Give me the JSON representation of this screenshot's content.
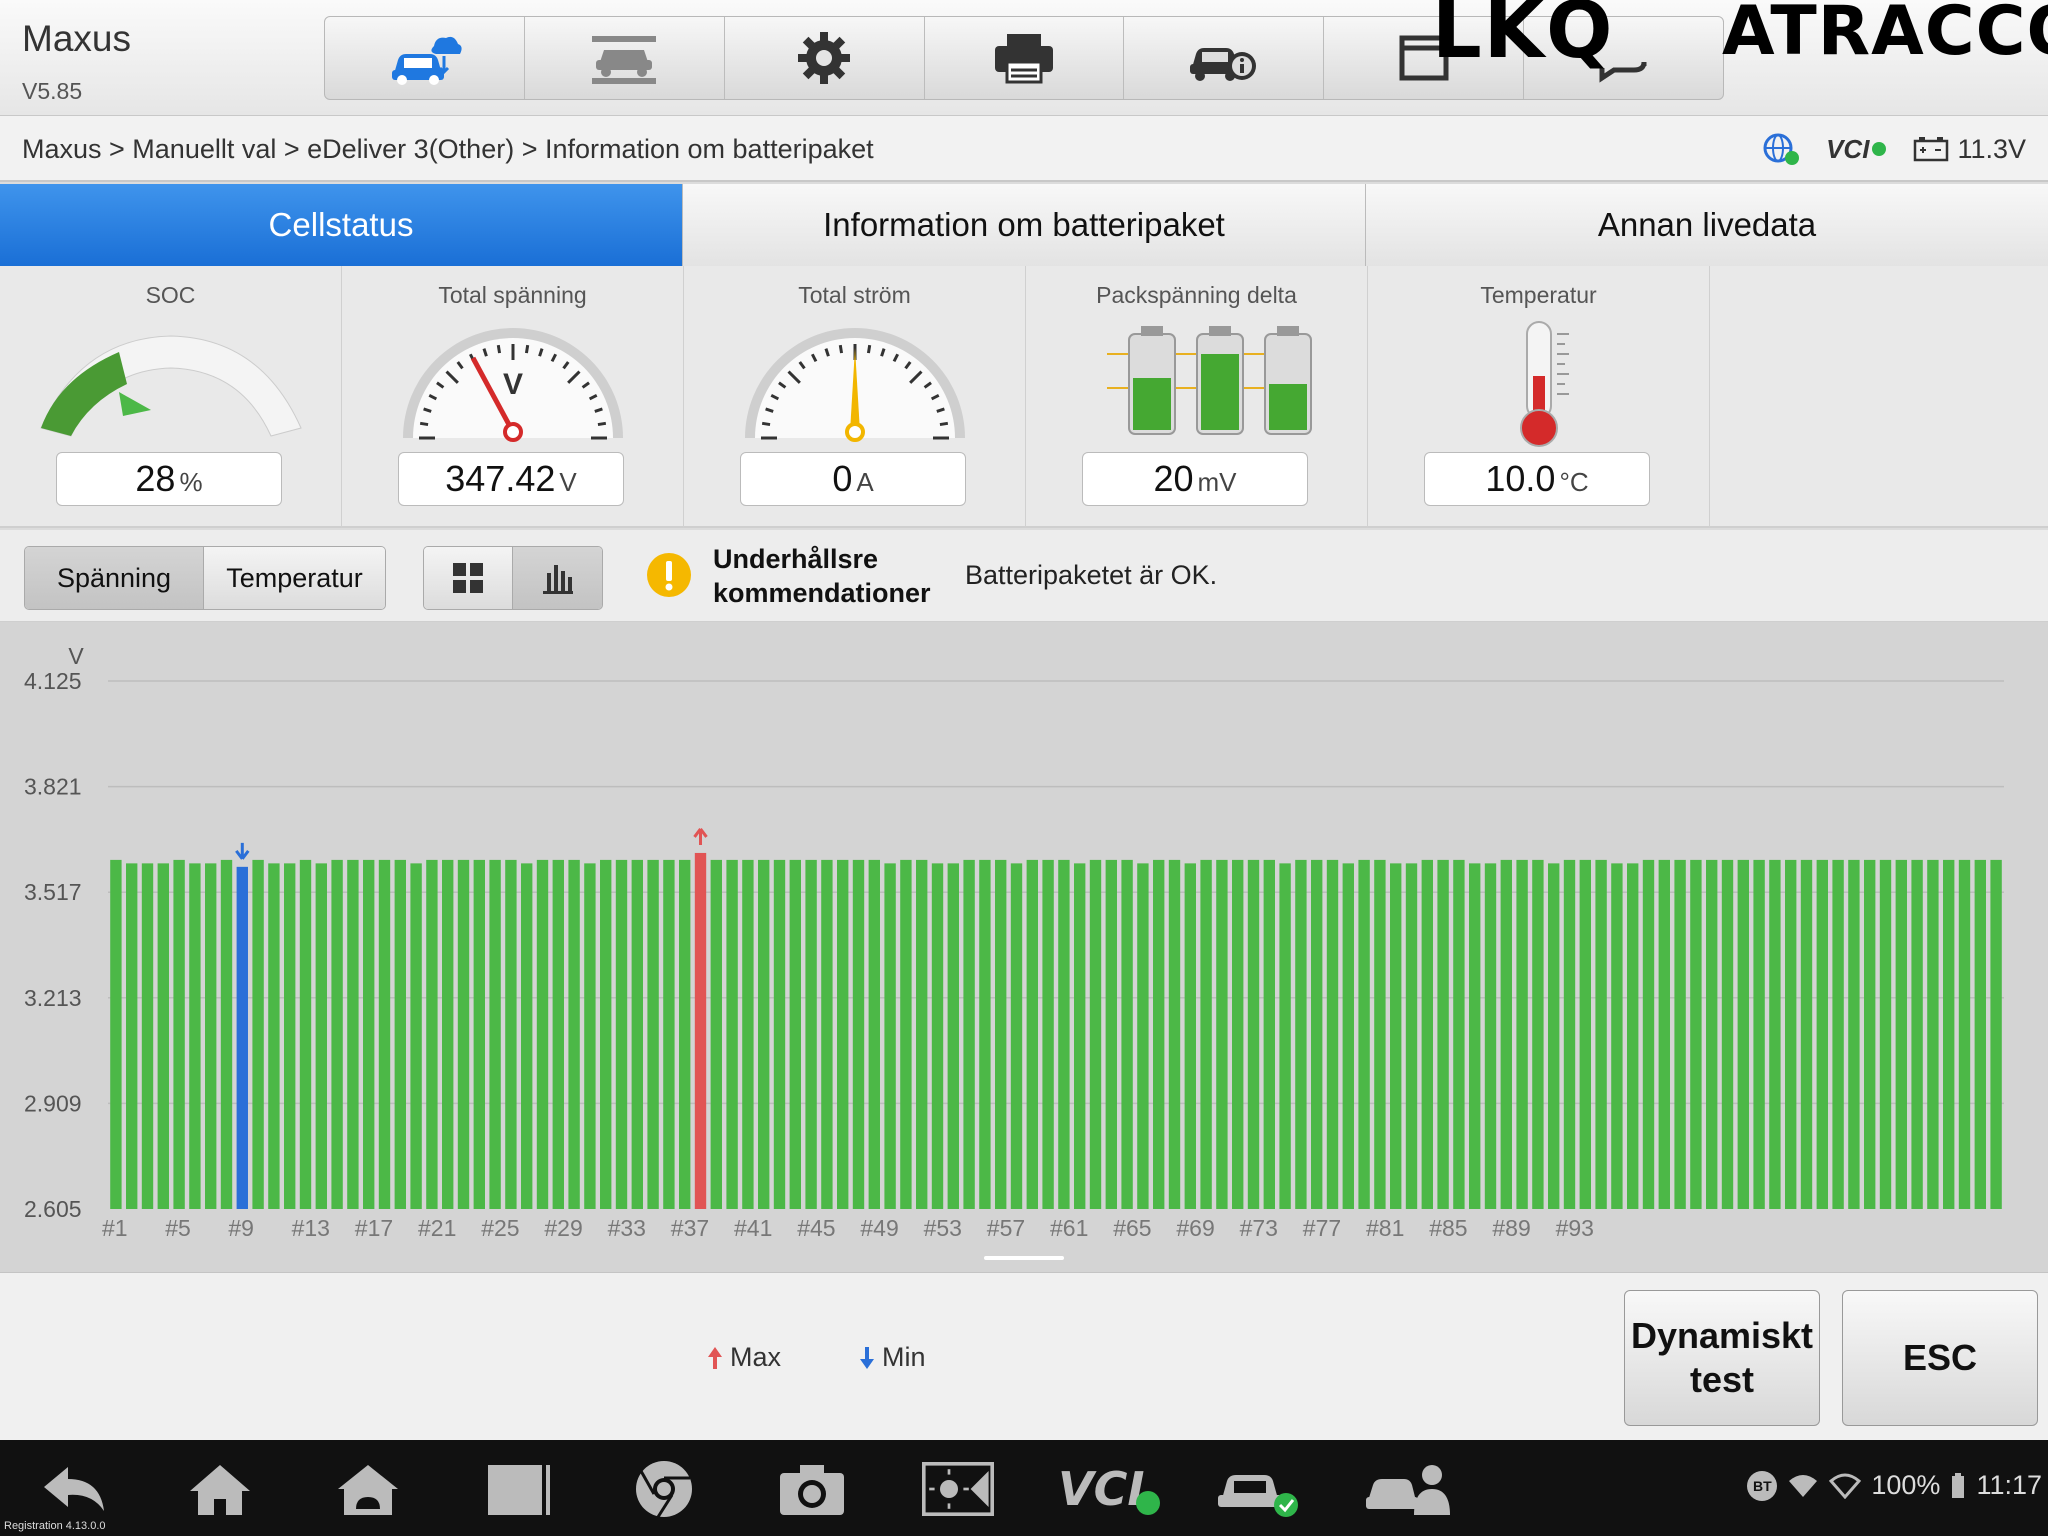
{
  "header": {
    "app_title": "Maxus",
    "version": "V5.85",
    "toolbar_icons": [
      "vehicle-cloud-icon",
      "lift-icon",
      "gear-icon",
      "printer-icon",
      "car-info-icon",
      "window-icon",
      "chat-icon"
    ],
    "brand_left": "LKQ",
    "brand_right": "ATRACCO"
  },
  "breadcrumb": {
    "path": "Maxus > Manuellt val > eDeliver 3(Other) > Information om batteripaket",
    "vci": "VCI",
    "battery_voltage": "11.3V"
  },
  "tabs": [
    {
      "label": "Cellstatus",
      "active": true
    },
    {
      "label": "Information om batteripaket",
      "active": false
    },
    {
      "label": "Annan livedata",
      "active": false
    }
  ],
  "gauges": {
    "soc": {
      "label": "SOC",
      "value": "28",
      "unit": "%",
      "fraction": 0.28
    },
    "voltage": {
      "label": "Total spänning",
      "value": "347.42",
      "unit": "V",
      "dial_letter": "V"
    },
    "current": {
      "label": "Total ström",
      "value": "0",
      "unit": "A"
    },
    "delta": {
      "label": "Packspänning delta",
      "value": "20",
      "unit": "mV"
    },
    "temperature": {
      "label": "Temperatur",
      "value": "10.0",
      "unit": "°C"
    }
  },
  "controls": {
    "voltage_btn": "Spänning",
    "temperature_btn": "Temperatur",
    "maintenance_label_1": "Underhållsre",
    "maintenance_label_2": "kommendationer",
    "maintenance_text": "Batteripaketet är OK."
  },
  "chart_data": {
    "type": "bar",
    "ylabel": "V",
    "y_ticks": [
      "4.125",
      "3.821",
      "3.517",
      "3.213",
      "2.909",
      "2.605"
    ],
    "ylim": [
      2.605,
      4.125
    ],
    "x_tick_labels": [
      "#1",
      "#5",
      "#9",
      "#13",
      "#17",
      "#21",
      "#25",
      "#29",
      "#33",
      "#37",
      "#41",
      "#45",
      "#49",
      "#53",
      "#57",
      "#61",
      "#65",
      "#69",
      "#73",
      "#77",
      "#81",
      "#85",
      "#89",
      "#93"
    ],
    "min_cell": 9,
    "max_cell": 38,
    "colors": {
      "normal": "#4cb847",
      "min": "#2a6fd8",
      "max": "#e15454"
    },
    "values": [
      3.61,
      3.6,
      3.6,
      3.6,
      3.61,
      3.6,
      3.6,
      3.61,
      3.59,
      3.61,
      3.6,
      3.6,
      3.61,
      3.6,
      3.61,
      3.61,
      3.61,
      3.61,
      3.61,
      3.6,
      3.61,
      3.61,
      3.61,
      3.61,
      3.61,
      3.61,
      3.6,
      3.61,
      3.61,
      3.61,
      3.6,
      3.61,
      3.61,
      3.61,
      3.61,
      3.61,
      3.61,
      3.63,
      3.61,
      3.61,
      3.61,
      3.61,
      3.61,
      3.61,
      3.61,
      3.61,
      3.61,
      3.61,
      3.61,
      3.6,
      3.61,
      3.61,
      3.6,
      3.6,
      3.61,
      3.61,
      3.61,
      3.6,
      3.61,
      3.61,
      3.61,
      3.6,
      3.61,
      3.61,
      3.61,
      3.6,
      3.61,
      3.61,
      3.6,
      3.61,
      3.61,
      3.61,
      3.61,
      3.61,
      3.6,
      3.61,
      3.61,
      3.61,
      3.6,
      3.61,
      3.61,
      3.6,
      3.6,
      3.61,
      3.61,
      3.61,
      3.6,
      3.6,
      3.61,
      3.61,
      3.61,
      3.6,
      3.61,
      3.61,
      3.61,
      3.6,
      3.6,
      3.61,
      3.61,
      3.61,
      3.61,
      3.61,
      3.61,
      3.61,
      3.61,
      3.61,
      3.61,
      3.61,
      3.61,
      3.61,
      3.61,
      3.61,
      3.61,
      3.61,
      3.61,
      3.61,
      3.61,
      3.61,
      3.61,
      3.61
    ]
  },
  "legend": {
    "max": "Max",
    "min": "Min"
  },
  "footer": {
    "dynamic_test": "Dynamiskt test",
    "esc": "ESC"
  },
  "navbar": {
    "icons": [
      "back-icon",
      "home-icon",
      "android-home-icon",
      "recents-icon",
      "browser-icon",
      "camera-icon",
      "brightness-icon",
      "vci-icon",
      "car-check-icon",
      "mechanic-icon"
    ],
    "battery_percent": "100%",
    "time": "11:17",
    "registration": "Registration 4.13.0.0"
  }
}
